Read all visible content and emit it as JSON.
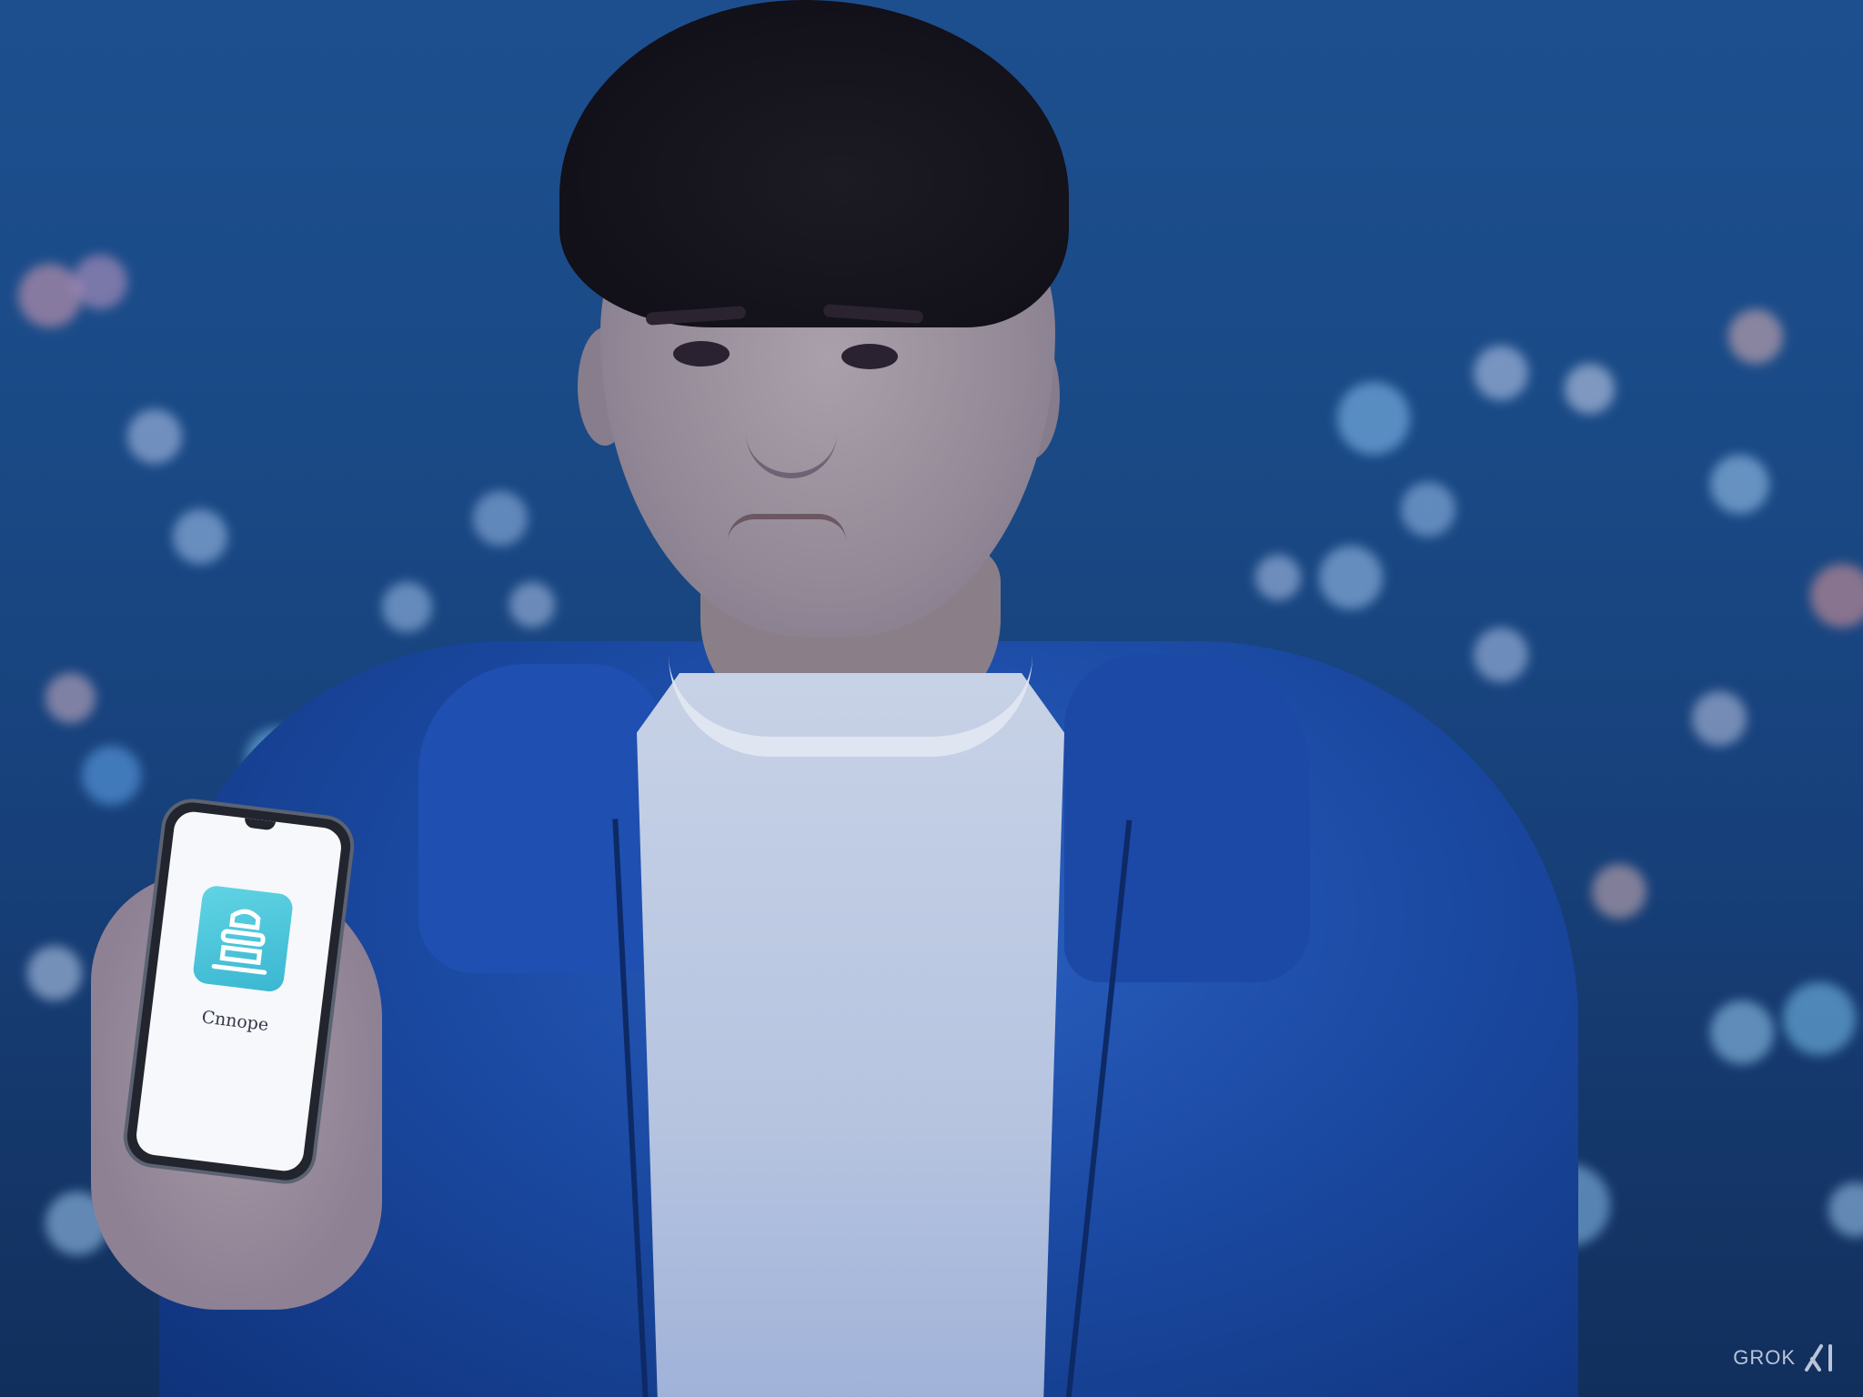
{
  "scene": {
    "subject": "person-holding-phone",
    "background": "night-city-bokeh"
  },
  "phone": {
    "app_label": "Cnnope",
    "app_icon": "stacked-bowl-app-icon",
    "screen_color": "#f6f8fb",
    "icon_color": "#3ab7d1"
  },
  "watermark": {
    "text": "GROK",
    "logo_icon": "xai-logo-icon"
  },
  "colors": {
    "hoodie": "#1b4aa3",
    "tshirt": "#c7d2e6",
    "sky": "#1d4f8f"
  }
}
